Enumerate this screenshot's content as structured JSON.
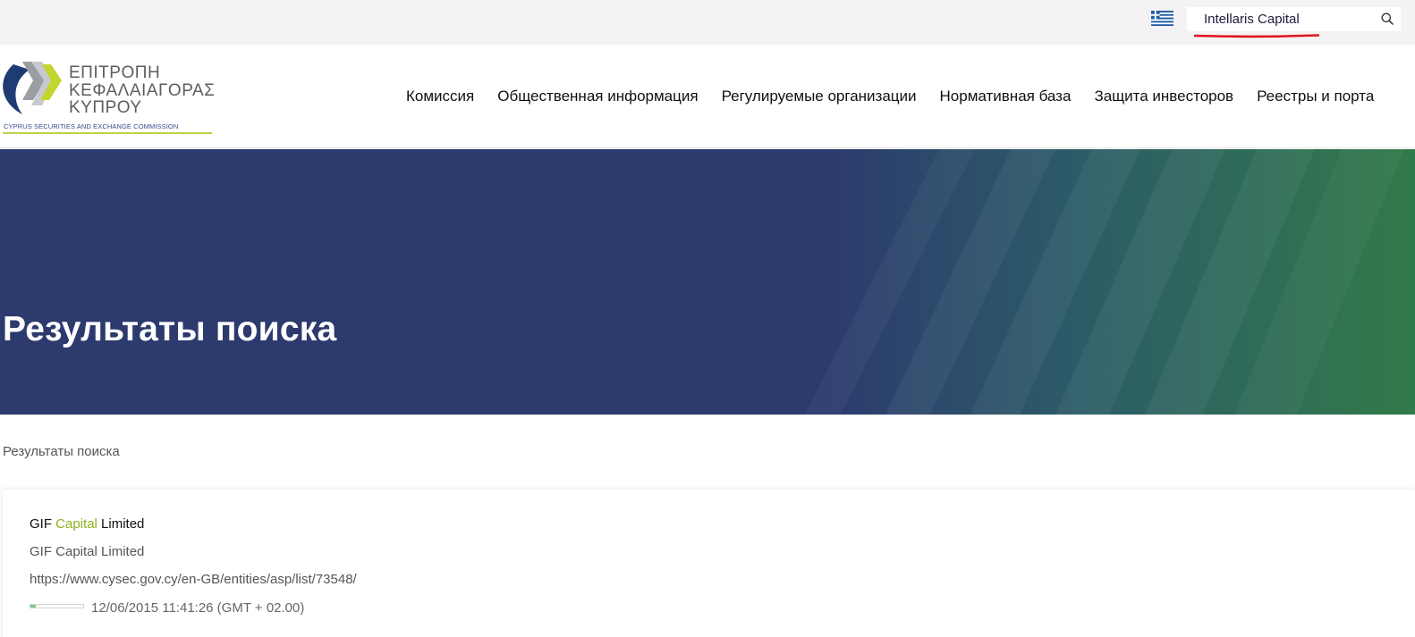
{
  "topbar": {
    "language_flag": "greek-flag-icon",
    "search": {
      "value": "Intellaris Capital",
      "placeholder": "",
      "icon": "search-icon"
    },
    "annotation_color": "#e0141e"
  },
  "logo": {
    "lines": [
      "ΕΠΙΤΡΟΠΗ",
      "ΚΕΦΑΛΑΙΑΓΟΡΑΣ",
      "ΚΥΠΡΟΥ"
    ],
    "subtitle": "CYPRUS SECURITIES AND EXCHANGE COMMISSION",
    "colors": {
      "navy": "#1f3b73",
      "lime": "#c3d530",
      "grey": "#8b8f94",
      "text": "#5a5e63"
    }
  },
  "nav": {
    "items": [
      {
        "label": "Комиссия"
      },
      {
        "label": "Общественная информация"
      },
      {
        "label": "Регулируемые организации"
      },
      {
        "label": "Нормативная база"
      },
      {
        "label": "Защита инвесторов"
      },
      {
        "label": "Реестры и порта"
      }
    ]
  },
  "hero": {
    "title": "Результаты поиска",
    "colors": {
      "base": "#2c3a6e",
      "teal": "#2c5a68",
      "green": "#317a4a"
    }
  },
  "breadcrumb": {
    "current": "Результаты поиска"
  },
  "results": [
    {
      "title_before": "GIF ",
      "title_highlight": "Capital",
      "title_after": " Limited",
      "description": "GIF Capital Limited",
      "url": "https://www.cysec.gov.cy/en-GB/entities/asp/list/73548/",
      "relevance_fraction": 0.1,
      "date": "12/06/2015 11:41:26 (GMT + 02.00)",
      "highlight_color": "#8fb21f"
    }
  ]
}
